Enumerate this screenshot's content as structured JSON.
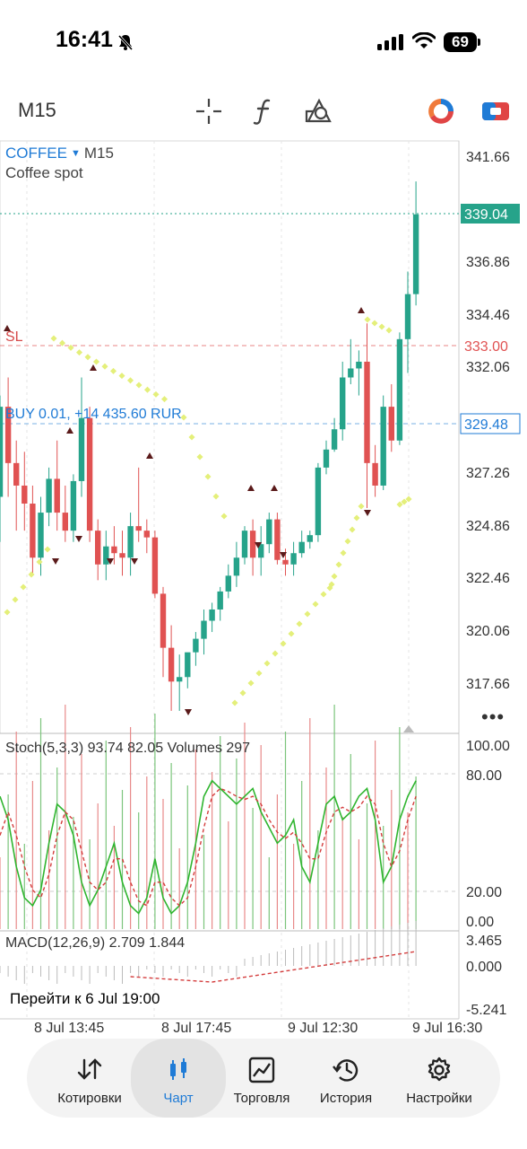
{
  "status_bar": {
    "time": "16:41",
    "battery": "69"
  },
  "toolbar": {
    "symbol_code": "M15",
    "icons": [
      "crosshair-icon",
      "function-icon",
      "objects-icon",
      "colored-circle-icon",
      "trade-toggle-icon"
    ]
  },
  "chart_header": {
    "symbol": "COFFEE",
    "timeframe": "M15",
    "description": "Coffee spot"
  },
  "price_axis": {
    "labels": [
      "341.66",
      "336.86",
      "334.46",
      "332.06",
      "327.26",
      "324.86",
      "322.46",
      "320.06",
      "317.66"
    ],
    "current_price": "339.04",
    "sl_price": "333.00",
    "buy_price": "329.48"
  },
  "order_lines": {
    "sl_label": "SL",
    "buy_label": "BUY 0.01, +14 435.60 RUR"
  },
  "stoch": {
    "label": "Stoch(5,3,3) 93.74 82.05 Volumes 297",
    "axis_labels": [
      "100.00",
      "80.00",
      "20.00",
      "0.00"
    ]
  },
  "macd": {
    "label": "MACD(12,26,9) 2.709 1.844",
    "axis_labels": [
      "3.465",
      "0.000",
      "-5.241"
    ]
  },
  "goto_text": "Перейти к 6 Jul 19:00",
  "time_axis": [
    "8 Jul 13:45",
    "8 Jul 17:45",
    "9 Jul 12:30",
    "9 Jul 16:30"
  ],
  "nav": [
    {
      "label": "Котировки",
      "icon": "quotes-icon"
    },
    {
      "label": "Чарт",
      "icon": "candles-icon",
      "active": true
    },
    {
      "label": "Торговля",
      "icon": "trade-icon"
    },
    {
      "label": "История",
      "icon": "history-icon"
    },
    {
      "label": "Настройки",
      "icon": "settings-icon"
    }
  ],
  "colors": {
    "bull": "#26a38a",
    "bear": "#e05252",
    "sar": "#e4ef7a",
    "accent": "#1f7bd6"
  },
  "chart_data": {
    "type": "candlestick",
    "symbol": "COFFEE",
    "timeframe": "M15",
    "candles": [
      [
        326.5,
        331.0,
        324.5,
        330.5
      ],
      [
        330.5,
        331.8,
        326.5,
        328.0
      ],
      [
        328.0,
        329.0,
        325.0,
        327.0
      ],
      [
        327.0,
        328.5,
        325.0,
        326.2
      ],
      [
        326.2,
        327.0,
        323.0,
        323.8
      ],
      [
        323.8,
        326.5,
        323.0,
        325.8
      ],
      [
        325.8,
        327.8,
        325.2,
        327.3
      ],
      [
        327.3,
        329.0,
        325.0,
        325.8
      ],
      [
        325.8,
        327.0,
        324.5,
        325.0
      ],
      [
        325.0,
        327.5,
        324.5,
        327.2
      ],
      [
        327.2,
        331.8,
        326.5,
        330.0
      ],
      [
        330.0,
        330.5,
        324.5,
        325.0
      ],
      [
        325.0,
        325.5,
        322.8,
        323.5
      ],
      [
        323.5,
        325.0,
        322.8,
        324.3
      ],
      [
        324.3,
        325.2,
        323.5,
        324.0
      ],
      [
        324.0,
        325.0,
        323.0,
        323.8
      ],
      [
        323.8,
        325.8,
        323.0,
        325.2
      ],
      [
        325.2,
        327.8,
        324.5,
        325.0
      ],
      [
        325.0,
        325.5,
        324.0,
        324.7
      ],
      [
        324.7,
        325.0,
        322.0,
        322.2
      ],
      [
        322.2,
        322.5,
        318.5,
        319.8
      ],
      [
        319.8,
        320.8,
        317.0,
        318.3
      ],
      [
        318.3,
        319.5,
        317.0,
        318.5
      ],
      [
        318.5,
        319.5,
        318.0,
        319.6
      ],
      [
        319.6,
        320.5,
        319.0,
        320.2
      ],
      [
        320.2,
        321.5,
        319.5,
        321.0
      ],
      [
        321.0,
        321.8,
        320.5,
        321.5
      ],
      [
        321.5,
        322.5,
        321.0,
        322.3
      ],
      [
        322.3,
        323.5,
        322.0,
        323.0
      ],
      [
        323.0,
        324.5,
        322.5,
        323.8
      ],
      [
        323.8,
        325.2,
        323.5,
        325.0
      ],
      [
        325.0,
        325.5,
        323.0,
        323.8
      ],
      [
        323.8,
        325.2,
        323.0,
        324.4
      ],
      [
        324.4,
        325.8,
        324.0,
        325.5
      ],
      [
        325.5,
        325.8,
        323.5,
        323.7
      ],
      [
        323.7,
        324.2,
        323.0,
        323.5
      ],
      [
        323.5,
        324.5,
        323.0,
        324.0
      ],
      [
        324.0,
        325.0,
        323.8,
        324.5
      ],
      [
        324.5,
        325.0,
        324.2,
        324.8
      ],
      [
        324.8,
        328.0,
        324.5,
        327.8
      ],
      [
        327.8,
        329.0,
        327.5,
        328.6
      ],
      [
        328.6,
        330.0,
        328.5,
        329.5
      ],
      [
        329.5,
        332.5,
        329.0,
        331.8
      ],
      [
        331.8,
        333.5,
        331.5,
        332.2
      ],
      [
        332.2,
        333.0,
        331.0,
        332.5
      ],
      [
        332.5,
        334.2,
        326.0,
        328.0
      ],
      [
        328.0,
        328.8,
        326.5,
        327.0
      ],
      [
        327.0,
        331.0,
        326.8,
        330.5
      ],
      [
        330.5,
        331.5,
        328.5,
        329.0
      ],
      [
        329.0,
        333.8,
        328.8,
        333.5
      ],
      [
        333.5,
        336.5,
        332.0,
        335.5
      ],
      [
        335.5,
        340.5,
        335.0,
        339.04
      ]
    ],
    "ylim": [
      316.0,
      342.3
    ]
  }
}
